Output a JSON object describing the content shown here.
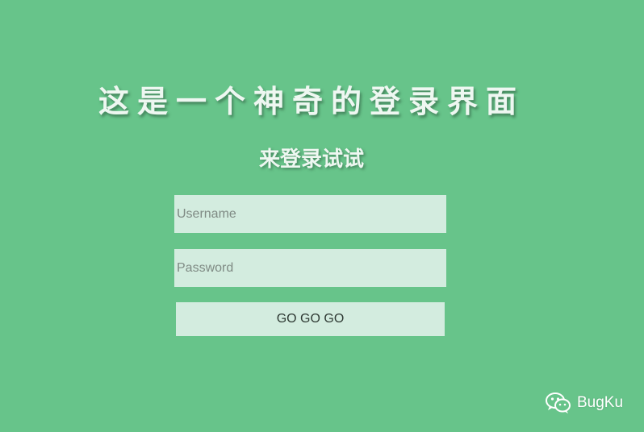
{
  "header": {
    "title": "这是一个神奇的登录界面",
    "subtitle": "来登录试试"
  },
  "form": {
    "username_placeholder": "Username",
    "password_placeholder": "Password",
    "submit_label": "GO GO GO"
  },
  "watermark": {
    "icon": "wechat-icon",
    "text": "BugKu"
  },
  "colors": {
    "background": "#67c48a",
    "field_background": "#d3ecdf",
    "title_text": "#eef7f1"
  }
}
